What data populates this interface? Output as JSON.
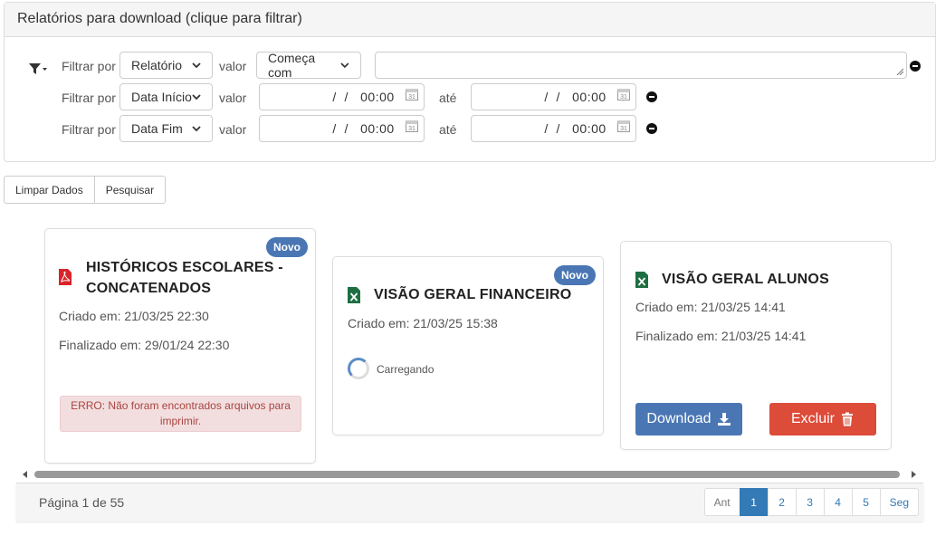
{
  "panel": {
    "title": "Relatórios para download (clique para filtrar)",
    "filters": [
      {
        "label": "Filtrar por",
        "field": "Relatório",
        "value_label": "valor",
        "operator": "Começa com",
        "text": ""
      },
      {
        "label": "Filtrar por",
        "field": "Data Início",
        "value_label": "valor",
        "from": " /  /   00:00",
        "until_label": "até",
        "to": " /  /   00:00"
      },
      {
        "label": "Filtrar por",
        "field": "Data Fim",
        "value_label": "valor",
        "from": " /  /   00:00",
        "until_label": "até",
        "to": " /  /   00:00"
      }
    ]
  },
  "actions": {
    "clear": "Limpar Dados",
    "search": "Pesquisar"
  },
  "cards": [
    {
      "badge": "Novo",
      "icon": "pdf-icon",
      "title_line1": "HISTÓRICOS ESCOLARES -",
      "title_line2": "CONCATENADOS",
      "created": "Criado em: 21/03/25 22:30",
      "finished": "Finalizado em: 29/01/24 22:30",
      "error": "ERRO: Não foram encontrados arquivos para imprimir."
    },
    {
      "badge": "Novo",
      "icon": "excel-icon",
      "title": "VISÃO GERAL FINANCEIRO",
      "created": "Criado em: 21/03/25 15:38",
      "loading": "Carregando"
    },
    {
      "icon": "excel-icon",
      "title": "VISÃO GERAL ALUNOS",
      "created": "Criado em: 21/03/25 14:41",
      "finished": "Finalizado em: 21/03/25 14:41",
      "download": "Download",
      "delete": "Excluir"
    }
  ],
  "footer": {
    "page_info": "Página 1 de 55",
    "prev": "Ant",
    "pages": [
      "1",
      "2",
      "3",
      "4",
      "5"
    ],
    "next": "Seg"
  },
  "colors": {
    "primary": "#4a77b4",
    "danger": "#dd4b39",
    "excel": "#1d6f42",
    "pdf": "#d9232a"
  }
}
